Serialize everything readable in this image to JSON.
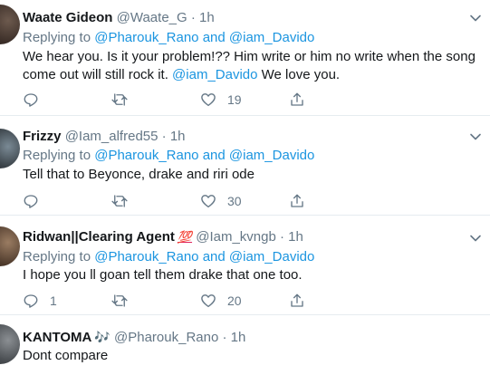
{
  "tweets": [
    {
      "name": "Waate Gideon",
      "handle": "@Waate_G",
      "time": "1h",
      "replying_prefix": "Replying to ",
      "replying_user1": "@Pharouk_Rano",
      "replying_and": " and ",
      "replying_user2": "@iam_Davido",
      "text_line1": "We hear you.  Is it your problem!?? Him write or him no write when the song",
      "text_line2_pre": "come out will still rock it. ",
      "text_mention": "@iam_Davido",
      "text_line2_post": "   We love you.",
      "replies": "",
      "retweets": "",
      "likes": "19"
    },
    {
      "name": "Frizzy",
      "handle": "@Iam_alfred55",
      "time": "1h",
      "replying_prefix": "Replying to ",
      "replying_user1": "@Pharouk_Rano",
      "replying_and": " and ",
      "replying_user2": "@iam_Davido",
      "text": "Tell that to Beyonce, drake and riri ode",
      "replies": "",
      "retweets": "",
      "likes": "30"
    },
    {
      "name": "Ridwan||Clearing Agent",
      "name_emoji": "💯",
      "handle": "@Iam_kvngb",
      "time": "1h",
      "replying_prefix": "Replying to ",
      "replying_user1": "@Pharouk_Rano",
      "replying_and": " and ",
      "replying_user2": "@iam_Davido",
      "text": "I hope you ll goan tell them drake that one too.",
      "replies": "1",
      "retweets": "",
      "likes": "20"
    },
    {
      "name": "KANTOMA",
      "name_emoji": "🎶",
      "handle": "@Pharouk_Rano",
      "time": "1h",
      "text": "Dont compare"
    }
  ],
  "separator": "·",
  "icons": {
    "reply": "reply-icon",
    "retweet": "retweet-icon",
    "like": "heart-icon",
    "share": "share-icon",
    "more": "chevron-down-icon"
  },
  "colors": {
    "link": "#1b95e0",
    "secondary": "#657786",
    "text": "#14171a",
    "divider": "#e6ecf0"
  }
}
